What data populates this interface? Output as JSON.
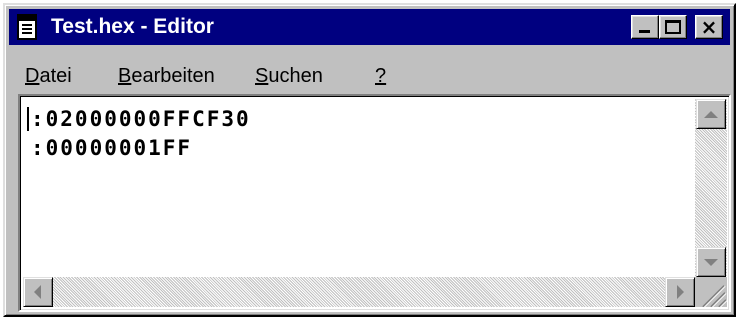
{
  "window": {
    "title": "Test.hex - Editor",
    "controls": {
      "minimize": "minimize-icon",
      "maximize": "maximize-icon",
      "close": "×"
    }
  },
  "menu": [
    {
      "mnemonic": "D",
      "rest": "atei"
    },
    {
      "mnemonic": "B",
      "rest": "earbeiten"
    },
    {
      "mnemonic": "S",
      "rest": "uchen"
    },
    {
      "mnemonic": "?",
      "rest": ""
    }
  ],
  "document": {
    "lines": [
      ":02000000FFCF30",
      ":00000001FF"
    ]
  },
  "colors": {
    "title_bar": "#000080",
    "face": "#c0c0c0",
    "text_background": "#ffffff"
  }
}
